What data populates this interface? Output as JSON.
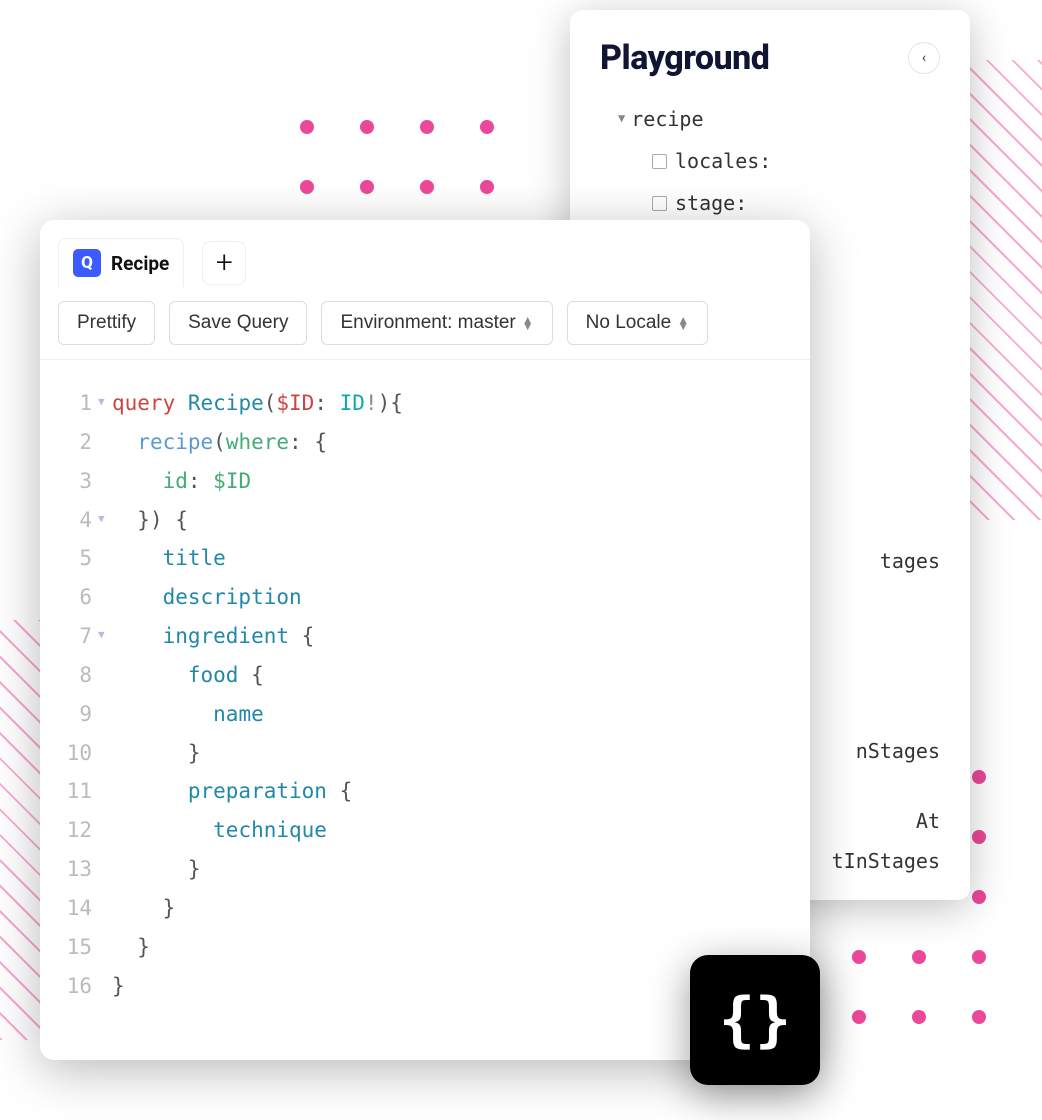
{
  "playground": {
    "title": "Playground",
    "tree": {
      "root": "recipe",
      "args": [
        {
          "label": "locales:"
        },
        {
          "label": "stage:"
        }
      ]
    },
    "fragments": [
      "tages",
      "nStages",
      "At",
      "tInStages"
    ]
  },
  "editor": {
    "tab": {
      "badge": "Q",
      "label": "Recipe"
    },
    "toolbar": {
      "prettify": "Prettify",
      "save": "Save Query",
      "env": "Environment: master",
      "locale": "No Locale"
    },
    "code": [
      {
        "n": 1,
        "fold": true,
        "html": "<span class='kw'>query</span> <span class='def'>Recipe</span><span class='txt'>(</span><span class='var'>$ID</span><span class='txt'>: </span><span class='type'>ID</span><span class='op'>!</span><span class='txt'>){</span>"
      },
      {
        "n": 2,
        "fold": false,
        "html": "  <span class='attr'>recipe</span><span class='txt'>(</span><span class='arg-key'>where</span><span class='txt'>: {</span>"
      },
      {
        "n": 3,
        "fold": false,
        "html": "    <span class='arg-key'>id</span><span class='txt'>: </span><span class='arg-val'>$ID</span>"
      },
      {
        "n": 4,
        "fold": true,
        "html": "  <span class='txt'>}) {</span>"
      },
      {
        "n": 5,
        "fold": false,
        "html": "    <span class='prop'>title</span>"
      },
      {
        "n": 6,
        "fold": false,
        "html": "    <span class='prop'>description</span>"
      },
      {
        "n": 7,
        "fold": true,
        "html": "    <span class='prop'>ingredient</span> <span class='txt'>{</span>"
      },
      {
        "n": 8,
        "fold": false,
        "html": "      <span class='prop'>food</span> <span class='txt'>{</span>"
      },
      {
        "n": 9,
        "fold": false,
        "html": "        <span class='prop'>name</span>"
      },
      {
        "n": 10,
        "fold": false,
        "html": "      <span class='txt'>}</span>"
      },
      {
        "n": 11,
        "fold": false,
        "html": "      <span class='prop'>preparation</span> <span class='txt'>{</span>"
      },
      {
        "n": 12,
        "fold": false,
        "html": "        <span class='prop'>technique</span>"
      },
      {
        "n": 13,
        "fold": false,
        "html": "      <span class='txt'>}</span>"
      },
      {
        "n": 14,
        "fold": false,
        "html": "    <span class='txt'>}</span>"
      },
      {
        "n": 15,
        "fold": false,
        "html": "  <span class='txt'>}</span>"
      },
      {
        "n": 16,
        "fold": false,
        "html": "<span class='txt'>}</span>"
      }
    ]
  },
  "badge": {
    "glyph": "{}"
  }
}
